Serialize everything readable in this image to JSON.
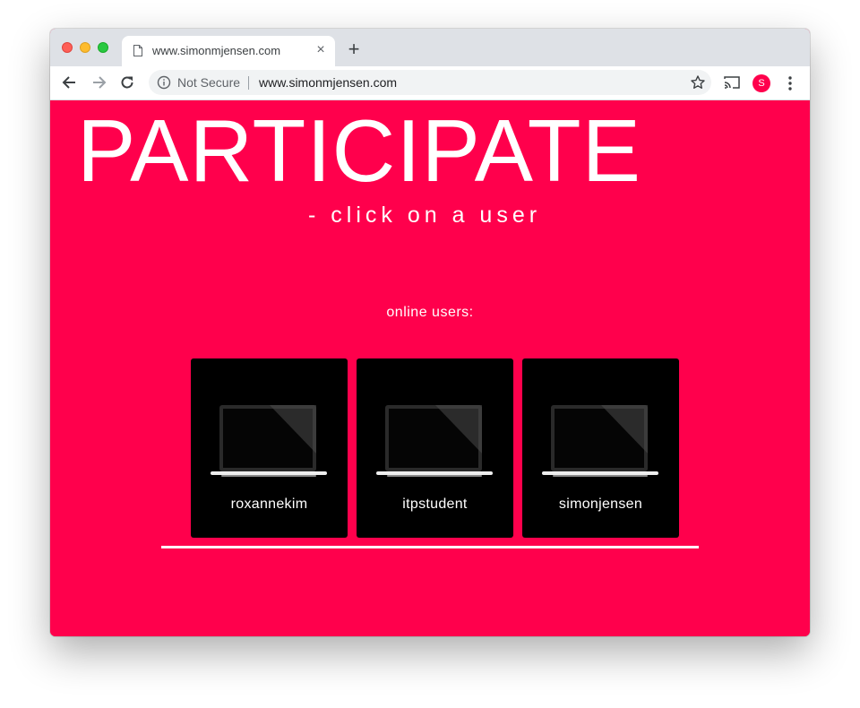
{
  "browser": {
    "tab_title": "www.simonmjensen.com",
    "tab_close": "×",
    "new_tab": "+",
    "security_label": "Not Secure",
    "url": "www.simonmjensen.com",
    "profile_initial": "S",
    "icons": [
      "close-window-icon",
      "minimize-window-icon",
      "zoom-window-icon",
      "page-icon",
      "back-icon",
      "forward-icon",
      "reload-icon",
      "info-icon",
      "star-icon",
      "cast-icon",
      "menu-icon"
    ]
  },
  "page": {
    "headline": "PARTICIPATE",
    "subhead": "- click on a user",
    "online_label": "online users:",
    "users": [
      {
        "name": "roxannekim"
      },
      {
        "name": "itpstudent"
      },
      {
        "name": "simonjensen"
      }
    ],
    "colors": {
      "background": "#ff004c",
      "card": "#000000",
      "text": "#ffffff"
    }
  }
}
